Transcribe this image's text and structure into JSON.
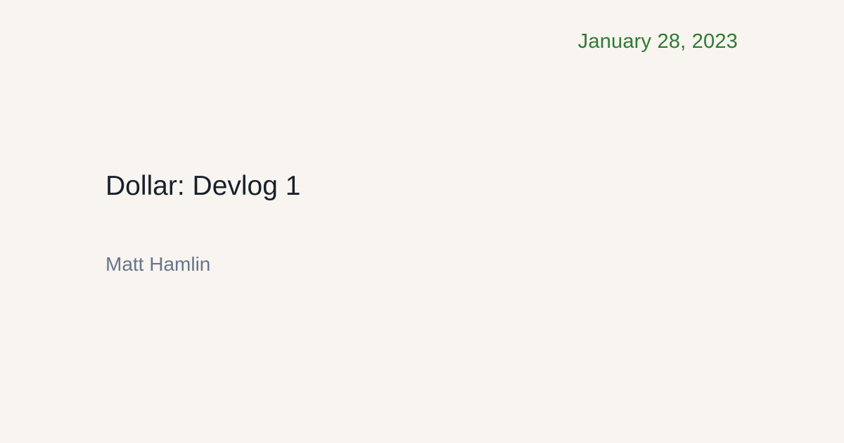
{
  "post": {
    "date": "January 28, 2023",
    "title": "Dollar: Devlog 1",
    "author": "Matt Hamlin"
  },
  "colors": {
    "background": "#f8f4ef",
    "date": "#2f7a34",
    "title": "#17202b",
    "author": "#67758d"
  }
}
